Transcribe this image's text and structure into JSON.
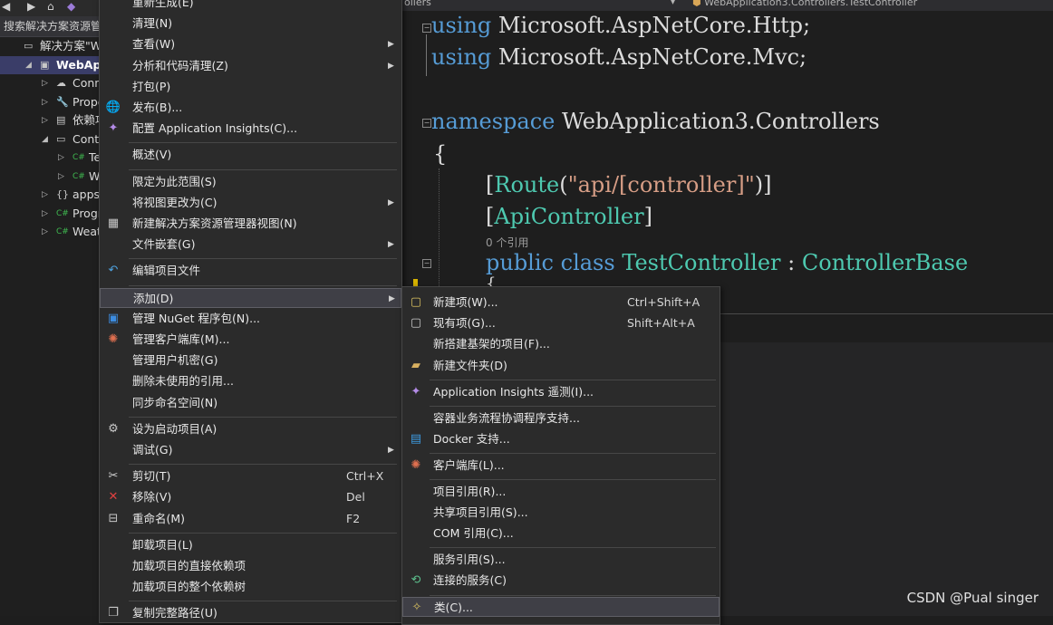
{
  "editor": {
    "tab_left": "ollers",
    "tab_right": "WebApplication3.Controllers.TestController",
    "code_lines": [
      {
        "kw1": "using",
        "rest": "Microsoft.AspNetCore.Http;"
      },
      {
        "kw1": "using",
        "rest": "Microsoft.AspNetCore.Mvc;"
      }
    ],
    "ns_kw": "namespace",
    "ns_name": "WebApplication3.Controllers",
    "brace": "{",
    "attr_route_open": "[",
    "attr_route_name": "Route",
    "attr_route_lp": "(",
    "attr_route_str": "\"api/[controller]\"",
    "attr_route_close": ")]",
    "attr_api_open": "[",
    "attr_api_name": "ApiController",
    "attr_api_close": "]",
    "refs": "0 个引用",
    "cls_public": "public",
    "cls_class": "class",
    "cls_name": "TestController",
    "cls_colon": ":",
    "cls_base": "ControllerBase",
    "brace2": "{"
  },
  "solution": {
    "search": "搜索解决方案资源管",
    "rows": [
      {
        "label": "解决方案\"We",
        "icon": "▭"
      },
      {
        "label": "WebApp",
        "icon": "▣",
        "selected": true
      },
      {
        "label": "Conn",
        "icon": "☁"
      },
      {
        "label": "Prope",
        "icon": "🔧"
      },
      {
        "label": "依赖项",
        "icon": "▤"
      },
      {
        "label": "Contr",
        "icon": "▭"
      },
      {
        "label": "Te",
        "icon": "C#"
      },
      {
        "label": "We",
        "icon": "C#"
      },
      {
        "label": "appse",
        "icon": "{}"
      },
      {
        "label": "Progr",
        "icon": "C#"
      },
      {
        "label": "Weath",
        "icon": "C#"
      }
    ]
  },
  "menu_main": [
    {
      "label": "重新生成(E)"
    },
    {
      "label": "清理(N)"
    },
    {
      "label": "查看(W)",
      "sub": true
    },
    {
      "label": "分析和代码清理(Z)",
      "sub": true
    },
    {
      "label": "打包(P)"
    },
    {
      "label": "发布(B)...",
      "icon": "globe"
    },
    {
      "label": "配置 Application Insights(C)...",
      "icon": "bulb"
    },
    {
      "sep": true
    },
    {
      "label": "概述(V)"
    },
    {
      "sep": true
    },
    {
      "label": "限定为此范围(S)"
    },
    {
      "label": "将视图更改为(C)",
      "sub": true
    },
    {
      "label": "新建解决方案资源管理器视图(N)",
      "icon": "views"
    },
    {
      "label": "文件嵌套(G)",
      "sub": true
    },
    {
      "sep": true
    },
    {
      "label": "编辑项目文件",
      "icon": "undo"
    },
    {
      "sep": true
    },
    {
      "label": "添加(D)",
      "sub": true,
      "highlight": true
    },
    {
      "label": "管理 NuGet 程序包(N)...",
      "icon": "nuget"
    },
    {
      "label": "管理客户端库(M)...",
      "icon": "libman"
    },
    {
      "label": "管理用户机密(G)"
    },
    {
      "label": "删除未使用的引用..."
    },
    {
      "label": "同步命名空间(N)"
    },
    {
      "sep": true
    },
    {
      "label": "设为启动项目(A)",
      "icon": "gear"
    },
    {
      "label": "调试(G)",
      "sub": true
    },
    {
      "sep": true
    },
    {
      "label": "剪切(T)",
      "shortcut": "Ctrl+X",
      "icon": "cut"
    },
    {
      "label": "移除(V)",
      "shortcut": "Del",
      "icon": "remove"
    },
    {
      "label": "重命名(M)",
      "shortcut": "F2",
      "icon": "rename"
    },
    {
      "sep": true
    },
    {
      "label": "卸载项目(L)"
    },
    {
      "label": "加载项目的直接依赖项"
    },
    {
      "label": "加载项目的整个依赖树"
    },
    {
      "sep": true
    },
    {
      "label": "复制完整路径(U)",
      "icon": "copy"
    }
  ],
  "menu_add": [
    {
      "label": "新建项(W)...",
      "shortcut": "Ctrl+Shift+A",
      "icon": "newitem"
    },
    {
      "label": "现有项(G)...",
      "shortcut": "Shift+Alt+A",
      "icon": "existing"
    },
    {
      "label": "新搭建基架的项目(F)..."
    },
    {
      "label": "新建文件夹(D)",
      "icon": "folder"
    },
    {
      "sep": true
    },
    {
      "label": "Application Insights 遥测(I)...",
      "icon": "bulb"
    },
    {
      "sep": true
    },
    {
      "label": "容器业务流程协调程序支持..."
    },
    {
      "label": "Docker 支持...",
      "icon": "docker"
    },
    {
      "sep": true
    },
    {
      "label": "客户端库(L)...",
      "icon": "libman"
    },
    {
      "sep": true
    },
    {
      "label": "项目引用(R)..."
    },
    {
      "label": "共享项目引用(S)..."
    },
    {
      "label": "COM 引用(C)..."
    },
    {
      "sep": true
    },
    {
      "label": "服务引用(S)..."
    },
    {
      "label": "连接的服务(C)",
      "icon": "connected"
    },
    {
      "sep": true
    },
    {
      "label": "类(C)...",
      "icon": "class",
      "highlight": true
    }
  ],
  "watermark": "CSDN @Pual singer"
}
